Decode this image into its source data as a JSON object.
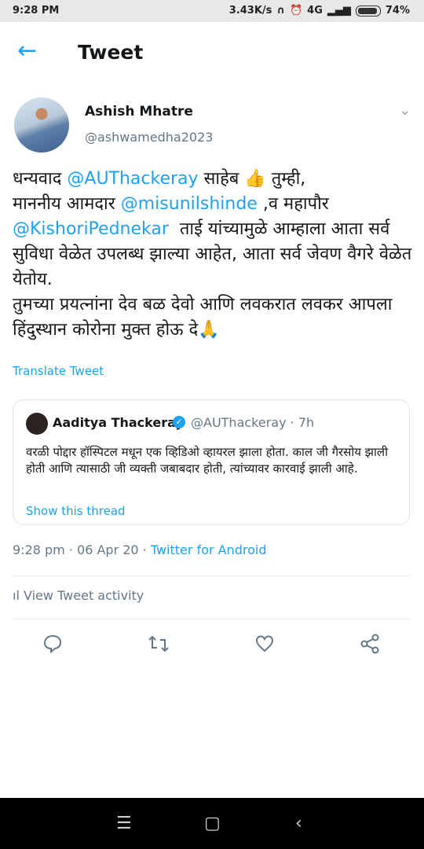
{
  "status_bar": {
    "time": "9:28 PM",
    "speed": "3.43K/s",
    "network": "4G",
    "battery": "74%"
  },
  "header": {
    "title": "Tweet"
  },
  "tweet": {
    "author_name": "Ashish Mhatre",
    "author_handle": "@ashwamedha2023",
    "text_parts": [
      {
        "t": "धन्यवाद ",
        "m": false
      },
      {
        "t": "@AUThackeray",
        "m": true
      },
      {
        "t": " साहेब 👍 तुम्ही,\nमाननीय आमदार ",
        "m": false
      },
      {
        "t": "@misunilshinde",
        "m": true
      },
      {
        "t": " ,व महापौर\n",
        "m": false
      },
      {
        "t": "@KishoriPednekar",
        "m": true
      },
      {
        "t": "  ताई यांच्यामुळे आम्हाला आता सर्व सुविधा वेळेत उपलब्ध झाल्या आहेत, आता सर्व जेवण वैगरे वेळेत येतोय.\nतुमच्या प्रयत्नांना देव बळ देवो आणि लवकरात लवकर आपला हिंदुस्थान कोरोना मुक्त होऊ दे🙏",
        "m": false
      }
    ],
    "translate_label": "Translate Tweet",
    "timestamp": "9:28 pm · 06 Apr 20 · ",
    "source": "Twitter for Android"
  },
  "quoted": {
    "name": "Aaditya Thackeray",
    "meta": "@AUThackeray · 7h",
    "text": "वरळी पोद्दार हॉस्पिटल मधून एक व्हिडिओ व्हायरल झाला होता. काल जी गैरसोय झाली होती आणि त्यासाठी जी व्यक्ती जबाबदार होती, त्यांच्यावर कारवाई झाली आहे.",
    "thread_label": "Show this thread"
  },
  "activity_label": "View Tweet activity",
  "icons": {
    "back": "arrow-left-icon",
    "reply": "reply-icon",
    "retweet": "retweet-icon",
    "like": "heart-icon",
    "share": "share-icon"
  },
  "colors": {
    "accent": "#1da1f2",
    "muted": "#657786"
  }
}
